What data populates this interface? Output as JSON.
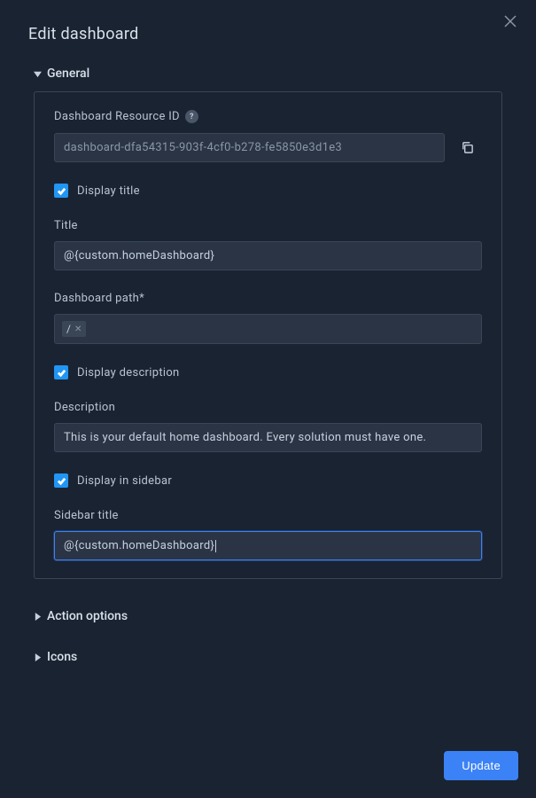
{
  "dialog": {
    "title": "Edit dashboard"
  },
  "sections": {
    "general": {
      "label": "General",
      "expanded": true
    },
    "actionOptions": {
      "label": "Action options",
      "expanded": false
    },
    "icons": {
      "label": "Icons",
      "expanded": false
    }
  },
  "fields": {
    "resourceId": {
      "label": "Dashboard Resource ID",
      "value": "dashboard-dfa54315-903f-4cf0-b278-fe5850e3d1e3"
    },
    "displayTitle": {
      "label": "Display title",
      "checked": true
    },
    "title": {
      "label": "Title",
      "value": "@{custom.homeDashboard}"
    },
    "dashboardPath": {
      "label": "Dashboard path*",
      "chip": "/"
    },
    "displayDescription": {
      "label": "Display description",
      "checked": true
    },
    "description": {
      "label": "Description",
      "value": "This is your default home dashboard. Every solution must have one."
    },
    "displayInSidebar": {
      "label": "Display in sidebar",
      "checked": true
    },
    "sidebarTitle": {
      "label": "Sidebar title",
      "value": "@{custom.homeDashboard}"
    }
  },
  "buttons": {
    "update": "Update"
  }
}
